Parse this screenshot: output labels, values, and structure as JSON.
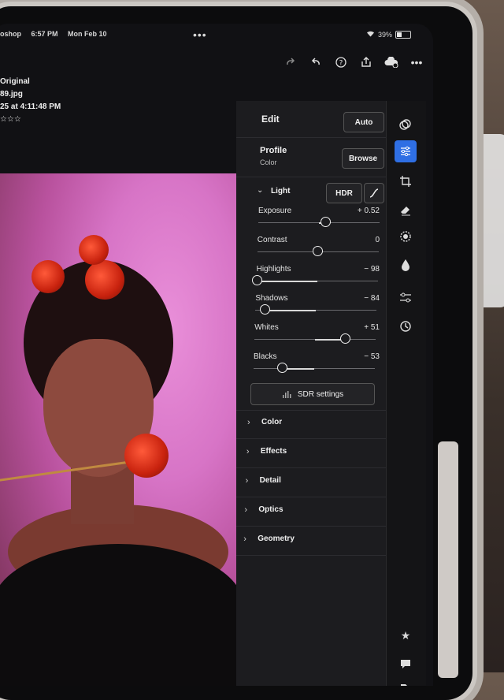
{
  "status_bar": {
    "app": "oshop",
    "time": "6:57 PM",
    "date": "Mon Feb 10",
    "battery": "39%",
    "battery_level": 0.39
  },
  "image_info": {
    "version": "Original",
    "filename": "89.jpg",
    "captured": "25 at 4:11:48 PM",
    "rating": "☆☆☆"
  },
  "toolbar": {
    "icons": [
      "redo-icon",
      "undo-icon",
      "help-icon",
      "share-icon",
      "cloud-sync-icon",
      "more-icon"
    ]
  },
  "edit_panel": {
    "title": "Edit",
    "auto_label": "Auto",
    "profile": {
      "label": "Profile",
      "value": "Color",
      "browse_label": "Browse"
    },
    "light": {
      "label": "Light",
      "hdr_label": "HDR",
      "sliders": [
        {
          "name": "Exposure",
          "value": "+ 0.52",
          "position": 0.56
        },
        {
          "name": "Contrast",
          "value": "0",
          "position": 0.5
        },
        {
          "name": "Highlights",
          "value": "− 98",
          "position": 0.01
        },
        {
          "name": "Shadows",
          "value": "− 84",
          "position": 0.08
        },
        {
          "name": "Whites",
          "value": "+ 51",
          "position": 0.75
        },
        {
          "name": "Blacks",
          "value": "− 53",
          "position": 0.24
        }
      ],
      "sdr_label": "SDR settings"
    },
    "sections": [
      "Color",
      "Effects",
      "Detail",
      "Optics",
      "Geometry"
    ]
  },
  "rail": {
    "icons": [
      "versions-icon",
      "edit-sliders-icon",
      "crop-icon",
      "eraser-icon",
      "masking-icon",
      "heal-icon",
      "presets-icon",
      "history-icon",
      "star-icon",
      "comment-icon",
      "tag-icon"
    ]
  }
}
